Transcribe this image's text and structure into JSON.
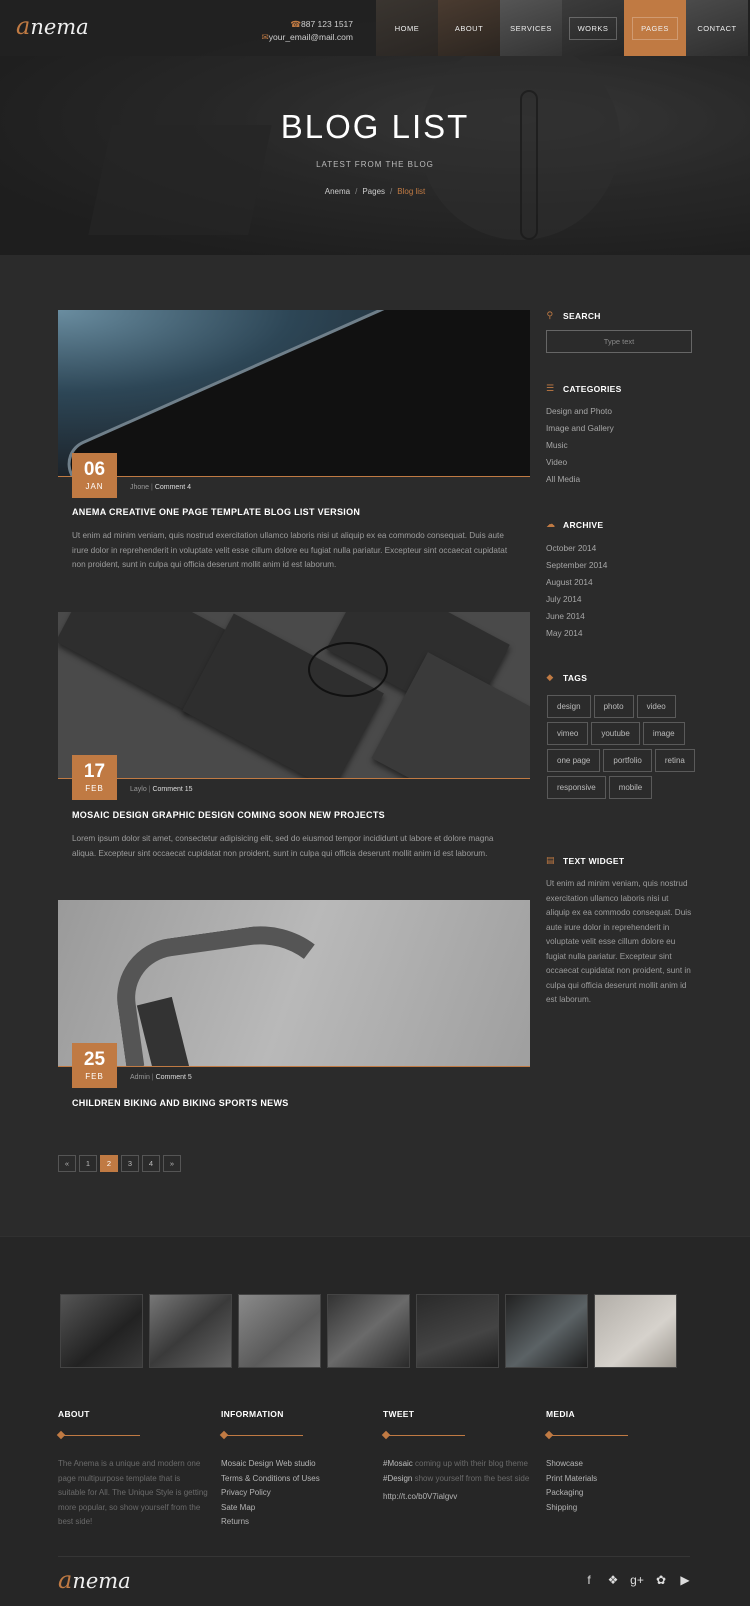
{
  "brand": {
    "logo_initial": "a",
    "logo_rest": "nema"
  },
  "header": {
    "phone": "887 123 1517",
    "email": "your_email@mail.com",
    "nav": [
      "HOME",
      "ABOUT",
      "SERVICES",
      "WORKS",
      "PAGES",
      "CONTACT"
    ],
    "active_nav": "PAGES"
  },
  "hero": {
    "title": "BLOG LIST",
    "subtitle": "LATEST FROM THE BLOG",
    "breadcrumb": [
      "Anema",
      "Pages",
      "Blog list"
    ]
  },
  "posts": [
    {
      "day": "06",
      "month": "JAN",
      "author": "Jhone",
      "comments": "Comment 4",
      "title": "ANEMA CREATIVE ONE PAGE TEMPLATE BLOG LIST VERSION",
      "excerpt": "Ut enim ad minim veniam, quis nostrud exercitation ullamco laboris nisi ut aliquip ex ea commodo consequat. Duis aute irure dolor in reprehenderit in voluptate velit esse cillum dolore eu fugiat nulla pariatur. Excepteur sint occaecat cupidatat non proident, sunt in culpa qui officia deserunt mollit anim id est laborum."
    },
    {
      "day": "17",
      "month": "FEB",
      "author": "Laylo",
      "comments": "Comment 15",
      "title": "MOSAIC DESIGN GRAPHIC DESIGN COMING SOON NEW PROJECTS",
      "excerpt": "Lorem ipsum dolor sit amet, consectetur adipisicing elit, sed do eiusmod tempor incididunt ut labore et dolore magna aliqua. Excepteur sint occaecat cupidatat non proident, sunt in culpa qui officia deserunt mollit anim id est laborum."
    },
    {
      "day": "25",
      "month": "FEB",
      "author": "Admin",
      "comments": "Comment 5",
      "title": "CHILDREN BIKING AND BIKING SPORTS NEWS",
      "excerpt": ""
    }
  ],
  "pagination": {
    "prev": "«",
    "pages": [
      "1",
      "2",
      "3",
      "4"
    ],
    "current": "2",
    "next": "»"
  },
  "sidebar": {
    "search": {
      "title": "SEARCH",
      "placeholder": "Type text"
    },
    "categories": {
      "title": "CATEGORIES",
      "items": [
        "Design and Photo",
        "Image and Gallery",
        "Music",
        "Video",
        "All Media"
      ]
    },
    "archive": {
      "title": "ARCHIVE",
      "items": [
        "October 2014",
        "September 2014",
        "August 2014",
        "July 2014",
        "June 2014",
        "May 2014"
      ]
    },
    "tags": {
      "title": "TAGS",
      "items": [
        "design",
        "photo",
        "video",
        "vimeo",
        "youtube",
        "image",
        "one page",
        "portfolio",
        "retina",
        "responsive",
        "mobile"
      ]
    },
    "text_widget": {
      "title": "TEXT WIDGET",
      "body": "Ut enim ad minim veniam, quis nostrud exercitation ullamco laboris nisi ut aliquip ex ea commodo consequat. Duis aute irure dolor in reprehenderit in voluptate velit esse cillum dolore eu fugiat nulla pariatur. Excepteur sint occaecat cupidatat non proident, sunt in culpa qui officia deserunt mollit anim id est laborum."
    }
  },
  "footer": {
    "about": {
      "title": "ABOUT",
      "body": "The Anema is a unique and modern one page multipurpose template that is suitable for All. The Unique Style is getting more popular, so show yourself from the best side!"
    },
    "information": {
      "title": "INFORMATION",
      "items": [
        "Mosaic Design Web studio",
        "Terms & Conditions of Uses",
        "Privacy Policy",
        "Sate Map",
        "Returns"
      ]
    },
    "tweet": {
      "title": "TWEET",
      "hashtag1": "#Mosaic",
      "text1": " coming up with their blog theme ",
      "hashtag2": "#Design",
      "text2": " show yourself from the best side",
      "link": "http://t.co/b0V7ialgvv"
    },
    "media": {
      "title": "MEDIA",
      "items": [
        "Showcase",
        "Print Materials",
        "Packaging",
        "Shipping"
      ]
    },
    "social_icons": [
      "facebook-icon",
      "dropbox-icon",
      "google-plus-icon",
      "twitter-icon",
      "youtube-icon"
    ]
  },
  "colors": {
    "accent": "#c07a43",
    "background": "#2b2b2b",
    "footer": "#262626"
  }
}
